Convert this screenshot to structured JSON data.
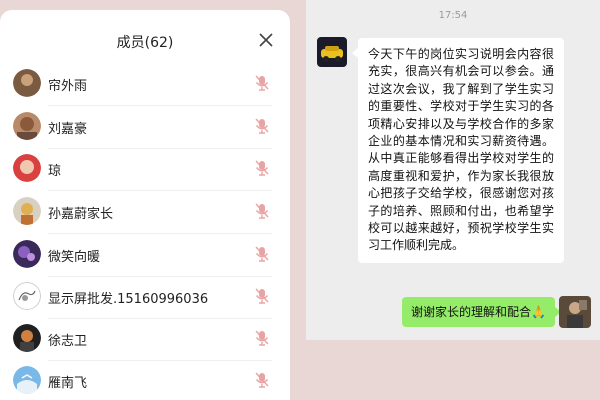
{
  "panel": {
    "title": "成员(62)",
    "members": [
      {
        "name": "帘外雨"
      },
      {
        "name": "刘嘉豪"
      },
      {
        "name": "琼"
      },
      {
        "name": "孙嘉蔚家长"
      },
      {
        "name": "微笑向暖"
      },
      {
        "name": "显示屏批发.15160996036"
      },
      {
        "name": "徐志卫"
      },
      {
        "name": "雁南飞"
      }
    ]
  },
  "chat": {
    "time": "17:54",
    "incoming_message": "今天下午的岗位实习说明会内容很充实，很高兴有机会可以参会。通过这次会议，我了解到了学生实习的重要性、学校对于学生实习的各项精心安排以及与学校合作的多家企业的基本情况和实习薪资待遇。从中真正能够看得出学校对学生的高度重视和爱护，作为家长我很放心把孩子交给学校，很感谢您对孩子的培养、照顾和付出，也希望学校可以越来越好，预祝学校学生实习工作顺利完成。",
    "outgoing_message": "谢谢家长的理解和配合🙏"
  },
  "colors": {
    "background": "#e9d7d5",
    "chat_background": "#ededed",
    "outgoing_bubble": "#95ec69",
    "mic_icon": "#e8a4a4"
  }
}
